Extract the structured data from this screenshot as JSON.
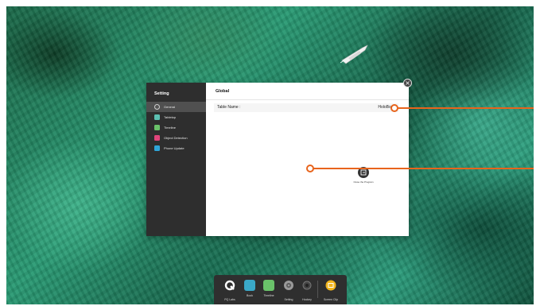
{
  "sidebar": {
    "title": "Setting",
    "items": [
      {
        "label": "General",
        "icon": "gear-icon",
        "color": "#6b6b6b",
        "active": true
      },
      {
        "label": "Tabletop",
        "icon": "tabletop-icon",
        "color": "#5cc0b2"
      },
      {
        "label": "Timeline",
        "icon": "timeline-icon",
        "color": "#6ac26a"
      },
      {
        "label": "Object Detection",
        "icon": "object-detection-icon",
        "color": "#e0457b"
      },
      {
        "label": "Phone Update",
        "icon": "phone-update-icon",
        "color": "#2fa6d9"
      }
    ]
  },
  "content": {
    "title": "Global",
    "table_name_label": "Table Name :",
    "table_name_value": "HoloBoard",
    "close_program_label": "Close the Program"
  },
  "dock": {
    "items": [
      {
        "label": "PQ Labs",
        "icon": "pqlabs-logo-icon",
        "color": "#ffffff"
      },
      {
        "label": "Book",
        "icon": "book-icon",
        "color": "#3aa8c8"
      },
      {
        "label": "Timeline",
        "icon": "timeline-icon",
        "color": "#6ac26a"
      },
      {
        "label": "Setting",
        "icon": "gear-icon",
        "color": "#9a9a9a"
      },
      {
        "label": "Hockey",
        "icon": "hockey-icon",
        "color": "#555555"
      },
      {
        "label": "Screen Clip",
        "icon": "screen-clip-icon",
        "color": "#f2b51c"
      }
    ]
  },
  "colors": {
    "callout": "#e8641c",
    "sidebar_bg": "#2e2e2e"
  }
}
